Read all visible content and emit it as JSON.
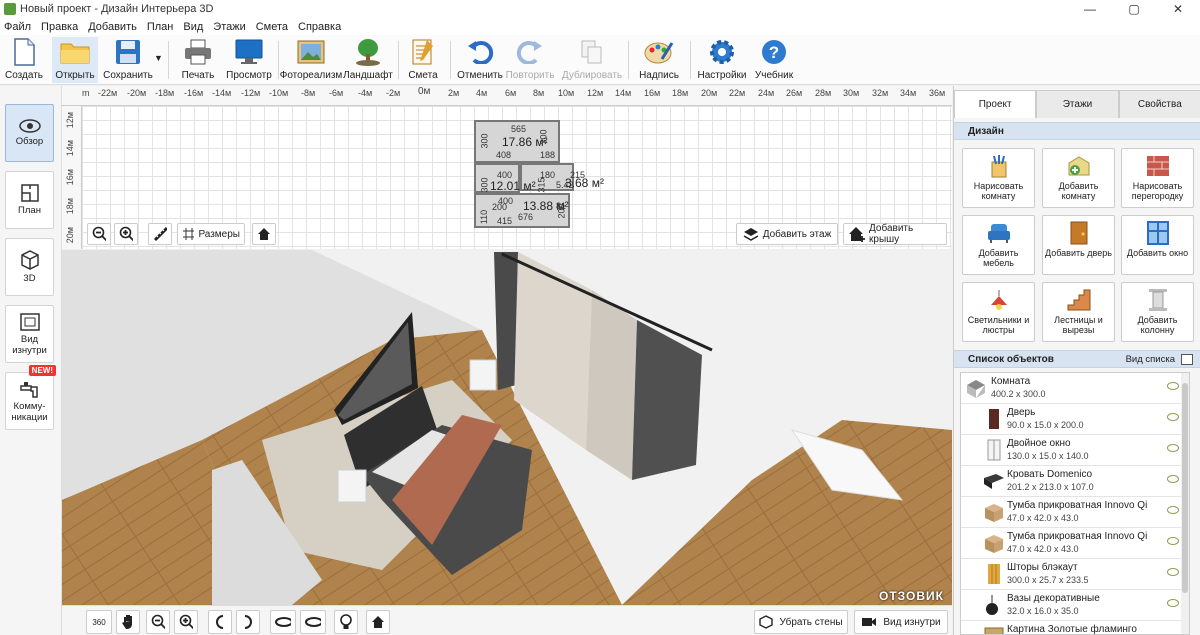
{
  "window": {
    "title": "Новый проект - Дизайн Интерьера 3D",
    "controls": [
      "—",
      "▢",
      "✕"
    ]
  },
  "menu": [
    "Файл",
    "Правка",
    "Добавить",
    "План",
    "Вид",
    "Этажи",
    "Смета",
    "Справка"
  ],
  "toolbar": [
    {
      "label": "Создать",
      "icon": "new-file-icon"
    },
    {
      "label": "Открыть",
      "icon": "folder-icon"
    },
    {
      "label": "Сохранить",
      "icon": "floppy-icon"
    },
    {
      "label": "Печать",
      "icon": "printer-icon"
    },
    {
      "label": "Просмотр",
      "icon": "monitor-icon"
    },
    {
      "label": "Фотореализм",
      "icon": "photo-icon"
    },
    {
      "label": "Ландшафт",
      "icon": "tree-icon"
    },
    {
      "label": "Смета",
      "icon": "estimate-icon"
    },
    {
      "label": "Отменить",
      "icon": "undo-icon"
    },
    {
      "label": "Повторить",
      "icon": "redo-icon"
    },
    {
      "label": "Дублировать",
      "icon": "duplicate-icon"
    },
    {
      "label": "Надпись",
      "icon": "palette-icon"
    },
    {
      "label": "Настройки",
      "icon": "gear-icon"
    },
    {
      "label": "Учебник",
      "icon": "help-icon"
    }
  ],
  "left_nav": [
    {
      "label": "Обзор",
      "icon": "eye-icon"
    },
    {
      "label": "План",
      "icon": "plan-icon"
    },
    {
      "label": "3D",
      "icon": "cube-icon"
    },
    {
      "label": "Вид изнутри",
      "icon": "inside-view-icon"
    },
    {
      "label": "Комму-никации",
      "icon": "faucet-icon",
      "badge": "NEW!"
    }
  ],
  "plan": {
    "ruler_x": [
      "m",
      "-22м",
      "-20м",
      "-18м",
      "-16м",
      "-14м",
      "-12м",
      "-10м",
      "-8м",
      "-6м",
      "-4м",
      "-2м",
      "0м",
      "2м",
      "4м",
      "6м",
      "8м",
      "10м",
      "12м",
      "14м",
      "16м",
      "18м",
      "20м",
      "22м",
      "24м",
      "26м",
      "28м",
      "30м",
      "32м",
      "34м",
      "36м"
    ],
    "ruler_y": [
      "12м",
      "14м",
      "16м",
      "18м",
      "20м"
    ],
    "labels": [
      "565",
      "17.86 м²",
      "300",
      "408",
      "188",
      "400",
      "180",
      "315",
      "215",
      "12.01 м²",
      "5.42",
      "3.68 м²",
      "300",
      "400",
      "13.88 м²",
      "110",
      "415",
      "676",
      "200",
      "81",
      "300",
      "200"
    ],
    "controls": {
      "dimensions": "Размеры",
      "add_floor": "Добавить этаж",
      "add_roof": "Добавить крышу"
    }
  },
  "bottom_controls": {
    "remove_walls": "Убрать стены",
    "inside_view": "Вид изнутри",
    "rotate_label": "360"
  },
  "right_panel": {
    "tabs": [
      "Проект",
      "Этажи",
      "Свойства"
    ],
    "design_header": "Дизайн",
    "design_buttons": [
      {
        "label": "Нарисовать комнату",
        "icon": "brush-icon"
      },
      {
        "label": "Добавить комнату",
        "icon": "add-room-icon"
      },
      {
        "label": "Нарисовать перегородку",
        "icon": "brick-icon"
      },
      {
        "label": "Добавить мебель",
        "icon": "armchair-icon"
      },
      {
        "label": "Добавить дверь",
        "icon": "door-icon"
      },
      {
        "label": "Добавить окно",
        "icon": "window-icon"
      },
      {
        "label": "Светильники и люстры",
        "icon": "lamp-icon"
      },
      {
        "label": "Лестницы и вырезы",
        "icon": "stairs-icon"
      },
      {
        "label": "Добавить колонну",
        "icon": "column-icon"
      }
    ],
    "objects_header": "Список объектов",
    "list_view": "Вид списка",
    "objects": [
      {
        "name": "Комната",
        "size": "400.2 x 300.0",
        "icon": "room-icon"
      },
      {
        "name": "Дверь",
        "size": "90.0 x 15.0 x 200.0",
        "icon": "door-icon"
      },
      {
        "name": "Двойное окно",
        "size": "130.0 x 15.0 x 140.0",
        "icon": "window-icon"
      },
      {
        "name": "Кровать Domenico",
        "size": "201.2 x 213.0 x 107.0",
        "icon": "bed-icon"
      },
      {
        "name": "Тумба прикроватная Innovo Qi",
        "size": "47.0 x 42.0 x 43.0",
        "icon": "nightstand-icon"
      },
      {
        "name": "Тумба прикроватная Innovo Qi",
        "size": "47.0 x 42.0 x 43.0",
        "icon": "nightstand-icon"
      },
      {
        "name": "Шторы блэкаут",
        "size": "300.0 x 25.7 x 233.5",
        "icon": "curtain-icon"
      },
      {
        "name": "Вазы декоративные",
        "size": "32.0 x 16.0 x 35.0",
        "icon": "vase-icon"
      },
      {
        "name": "Картина Золотые фламинго",
        "size": "",
        "icon": "picture-icon"
      }
    ]
  },
  "watermark": "ОТЗОВИК"
}
